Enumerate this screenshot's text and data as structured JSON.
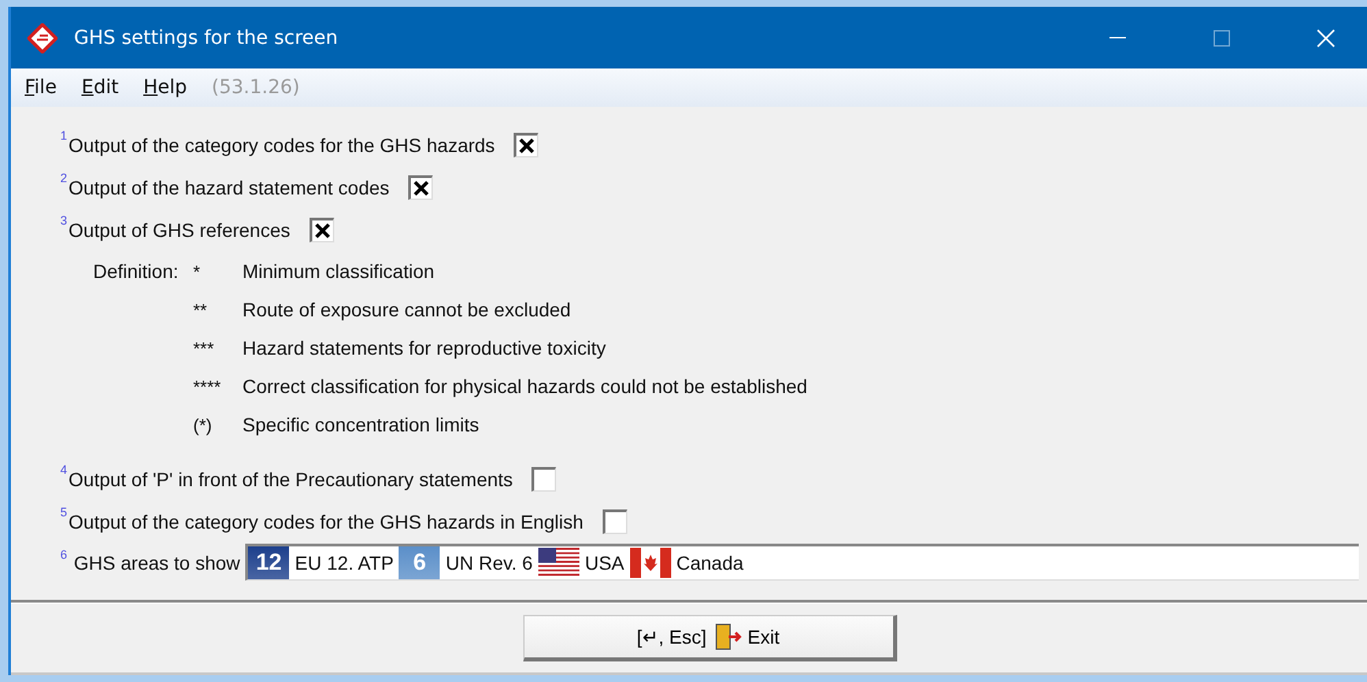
{
  "window": {
    "title": "GHS settings for the screen"
  },
  "menu": [
    {
      "label": "File",
      "disabled": false
    },
    {
      "label": "Edit",
      "disabled": false
    },
    {
      "label": "Help",
      "disabled": false
    },
    {
      "label": "(53.1.26)",
      "disabled": true
    }
  ],
  "options_top": [
    {
      "number": "1",
      "label": "Output of the category codes for the GHS hazards",
      "checked": true
    },
    {
      "number": "2",
      "label": "Output of the hazard statement codes",
      "checked": true
    },
    {
      "number": "3",
      "label": "Output of GHS references",
      "checked": true
    }
  ],
  "definition": {
    "label": "Definition:",
    "items": [
      {
        "mark": "*",
        "text": "Minimum classification"
      },
      {
        "mark": "**",
        "text": "Route of exposure cannot be excluded"
      },
      {
        "mark": "***",
        "text": "Hazard statements for reproductive toxicity"
      },
      {
        "mark": "****",
        "text": "Correct classification for physical hazards could not be established"
      },
      {
        "mark": "(*)",
        "text": "Specific concentration limits"
      }
    ]
  },
  "options_bottom": [
    {
      "number": "4",
      "label": "Output of 'P' in front of the Precautionary statements",
      "checked": false
    },
    {
      "number": "5",
      "label": "Output of the category codes for the GHS hazards in English",
      "checked": false
    }
  ],
  "areas": {
    "number": "6",
    "label": "GHS areas to show",
    "items": [
      {
        "kind": "badge",
        "badge": "12",
        "color": "#1c3f8c",
        "text": "EU 12. ATP"
      },
      {
        "kind": "badge",
        "badge": "6",
        "color": "#5b8fc9",
        "text": "UN Rev. 6"
      },
      {
        "kind": "us-flag",
        "text": "USA"
      },
      {
        "kind": "ca-flag",
        "text": "Canada"
      }
    ]
  },
  "exit_button": {
    "shortcut": "[↵, Esc]",
    "label": "Exit"
  }
}
